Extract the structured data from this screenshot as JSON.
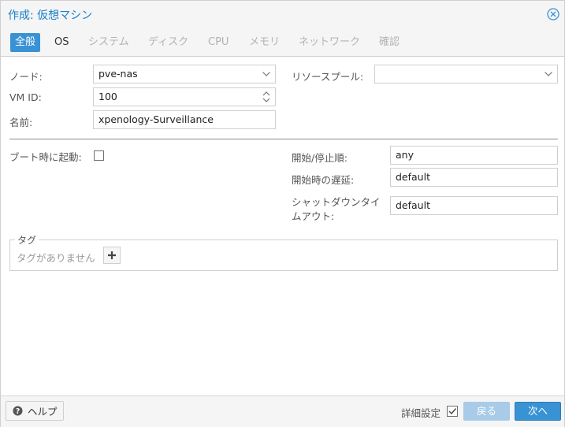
{
  "dialog": {
    "title": "作成: 仮想マシン"
  },
  "tabs": [
    {
      "label": "全般",
      "state": "active"
    },
    {
      "label": "OS",
      "state": "enabled"
    },
    {
      "label": "システム",
      "state": "disabled"
    },
    {
      "label": "ディスク",
      "state": "disabled"
    },
    {
      "label": "CPU",
      "state": "disabled"
    },
    {
      "label": "メモリ",
      "state": "disabled"
    },
    {
      "label": "ネットワーク",
      "state": "disabled"
    },
    {
      "label": "確認",
      "state": "disabled"
    }
  ],
  "general": {
    "node_label": "ノード:",
    "node_value": "pve-nas",
    "vmid_label": "VM ID:",
    "vmid_value": "100",
    "name_label": "名前:",
    "name_value": "xpenology-Surveillance",
    "pool_label": "リソースプール:",
    "pool_value": "",
    "onboot_label": "ブート時に起動:",
    "onboot_checked": false,
    "order_label": "開始/停止順:",
    "order_value": "any",
    "startup_delay_label": "開始時の遅延:",
    "startup_delay_value": "default",
    "shutdown_timeout_label_line1": "シャットダウンタイ",
    "shutdown_timeout_label_line2": "ムアウト:",
    "shutdown_timeout_value": "default"
  },
  "tags": {
    "legend": "タグ",
    "empty_text": "タグがありません"
  },
  "footer": {
    "help_label": "ヘルプ",
    "advanced_label": "詳細設定",
    "advanced_checked": true,
    "back_label": "戻る",
    "next_label": "次へ"
  },
  "colors": {
    "accent": "#3892d4",
    "title": "#157fcc",
    "disabled_button": "#a8cbe8"
  }
}
